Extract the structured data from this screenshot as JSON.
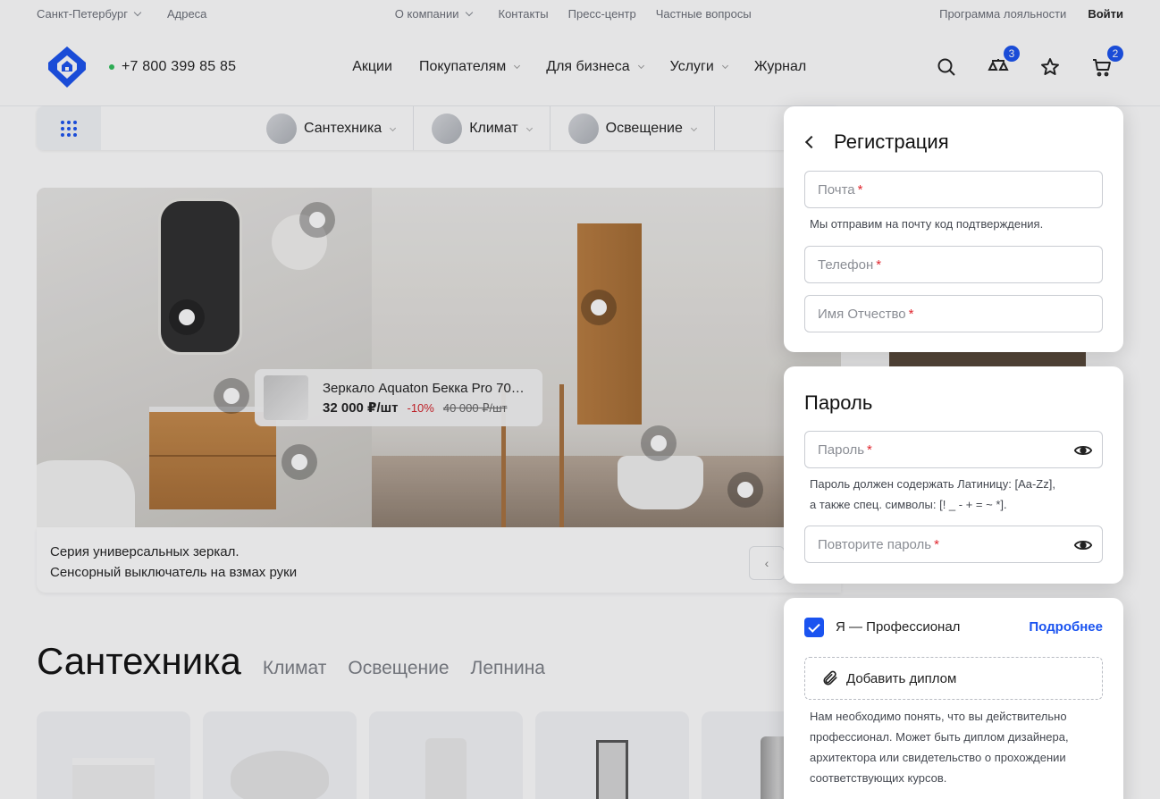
{
  "topbar": {
    "city": "Санкт-Петербург",
    "addresses": "Адреса",
    "about": "О компании",
    "contacts": "Контакты",
    "press": "Пресс-центр",
    "faq": "Частные вопросы",
    "loyalty": "Программа лояльности",
    "login": "Войти"
  },
  "header": {
    "phone": "+7 800 399 85 85",
    "nav": [
      "Акции",
      "Покупателям",
      "Для бизнеса",
      "Услуги",
      "Журнал"
    ],
    "compare_count": "3",
    "cart_count": "2"
  },
  "categories": [
    "Сантехника",
    "Климат",
    "Освещение"
  ],
  "hero": {
    "product_name": "Зеркало Aquaton Бекка Pro 70…",
    "price": "32 000 ₽/шт",
    "discount": "-10%",
    "old_price": "40 000 ₽/шт",
    "caption_line1": "Серия универсальных зеркал.",
    "caption_line2": "Сенсорный выключатель на взмах руки"
  },
  "section": {
    "active": "Сантехника",
    "tabs": [
      "Климат",
      "Освещение",
      "Лепнина"
    ]
  },
  "registration": {
    "title": "Регистрация",
    "email_placeholder": "Почта",
    "email_hint": "Мы отправим на почту код подтверждения.",
    "phone_placeholder": "Телефон",
    "name_placeholder": "Имя Отчество",
    "required_mark": "*"
  },
  "password": {
    "title": "Пароль",
    "password_placeholder": "Пароль",
    "hint_line1": "Пароль должен содержать Латиницу: [Aa-Zz],",
    "hint_line2": "а также спец. символы: [! _ - + = ~ *].",
    "repeat_placeholder": "Повторите пароль"
  },
  "professional": {
    "checked": true,
    "label": "Я — Профессионал",
    "more_link": "Подробнее",
    "upload_label": "Добавить диплом",
    "hint": "Нам необходимо понять, что вы действительно профессионал. Может быть диплом дизайнера, архитектора или свидетельство о прохождении соответствующих курсов."
  },
  "colors": {
    "accent": "#1a53f0",
    "required": "#e0262e",
    "discount": "#d31f26",
    "online": "#2fbf5a"
  }
}
